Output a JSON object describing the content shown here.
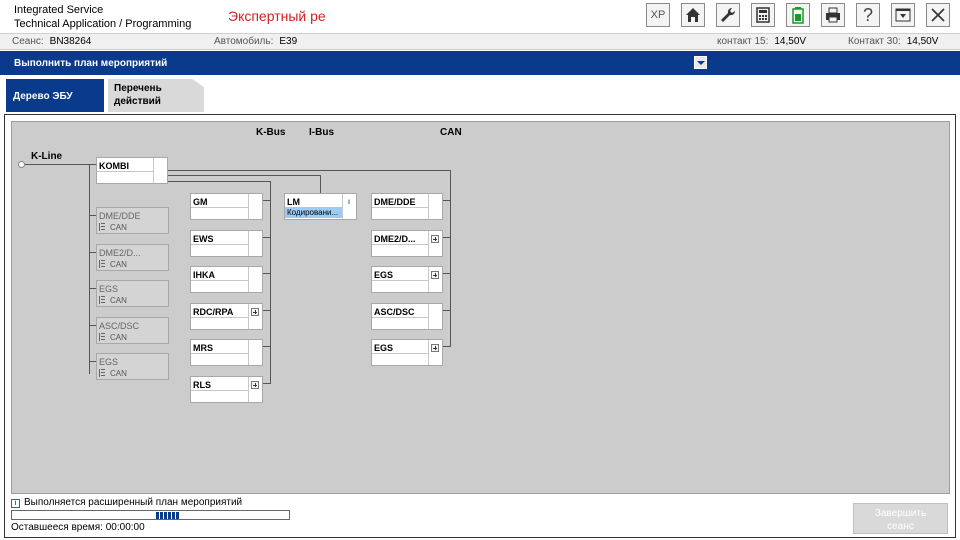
{
  "app": {
    "title_line1": "Integrated Service",
    "title_line2": "Technical Application / Programming",
    "mode": "Экспертный ре"
  },
  "toolbar": {
    "xp_label": "XP",
    "help_label": "?"
  },
  "session": {
    "session_label": "Сеанс:",
    "session_value": "BN38264",
    "car_label": "Автомобиль:",
    "car_value": "E39",
    "k15_label": "контакт 15:",
    "k15_value": "14,50V",
    "k30_label": "Контакт 30:",
    "k30_value": "14,50V"
  },
  "plan_bar": {
    "title": "Выполнить план мероприятий"
  },
  "tabs": {
    "active": "Дерево ЭБУ",
    "inactive_line1": "Перечень",
    "inactive_line2": "действий"
  },
  "tree": {
    "buses": {
      "kbus": "K-Bus",
      "ibus": "I-Bus",
      "can": "CAN",
      "kline": "K-Line"
    },
    "kombi": "KOMBI",
    "kline_modules": [
      {
        "name": "DME/DDE",
        "sub": "CAN"
      },
      {
        "name": "DME2/D...",
        "sub": "CAN"
      },
      {
        "name": "EGS",
        "sub": "CAN"
      },
      {
        "name": "ASC/DSC",
        "sub": "CAN"
      },
      {
        "name": "EGS",
        "sub": "CAN"
      }
    ],
    "kbus_modules": [
      "GM",
      "EWS",
      "IHKA",
      "RDC/RPA",
      "MRS",
      "RLS"
    ],
    "ibus_modules": [
      {
        "name": "LM",
        "status": "Кодировани..."
      }
    ],
    "can_modules": [
      "DME/DDE",
      "DME2/D...",
      "EGS",
      "ASC/DSC",
      "EGS"
    ]
  },
  "status": {
    "message": "Выполняется расширенный план мероприятий",
    "remaining": "Оставшееся время: 00:00:00",
    "progress_fraction": 0.09
  },
  "finish_button": {
    "line1": "Завершить",
    "line2": "сеанс"
  },
  "colors": {
    "header_blue": "#0a3a8c",
    "mode_red": "#d42020",
    "tree_bg": "#cccccc",
    "highlight": "#9dcbf3"
  }
}
